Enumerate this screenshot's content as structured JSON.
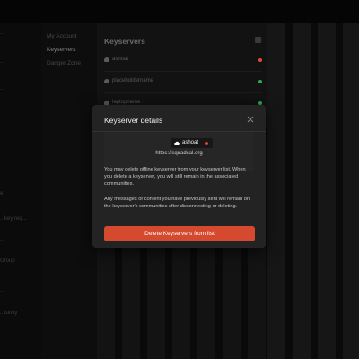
{
  "nav": {
    "items": [
      {
        "label": "My Account",
        "active": false
      },
      {
        "label": "Keyservers",
        "active": true
      },
      {
        "label": "Danger Zone",
        "active": false
      }
    ]
  },
  "left_items": [
    "...",
    "...",
    "...",
    "e",
    "...key req...",
    "...",
    "Group",
    "...",
    "...tunity"
  ],
  "main": {
    "title": "Keyservers",
    "rows": [
      {
        "name": "ashoat",
        "status_color": "#e04a3a"
      },
      {
        "name": "placeholdername",
        "status_color": "#2fa84f"
      },
      {
        "name": "laptopname",
        "status_color": "#2fa84f"
      }
    ]
  },
  "modal": {
    "title": "Keyserver details",
    "keyserver_name": "ashoat",
    "keyserver_url": "https://squadcal.org",
    "status_color": "#e04a3a",
    "paragraph1": "You may delete offline keyserver from your keyserver list. When you delete a keyserver, you will still remain in the associated communities.",
    "paragraph2": "Any messages or content you have previously sent will remain on the keyserver's communities after disconnecting or deleting.",
    "delete_label": "Delete Keyservers from list",
    "accent_color": "#d5492e"
  }
}
